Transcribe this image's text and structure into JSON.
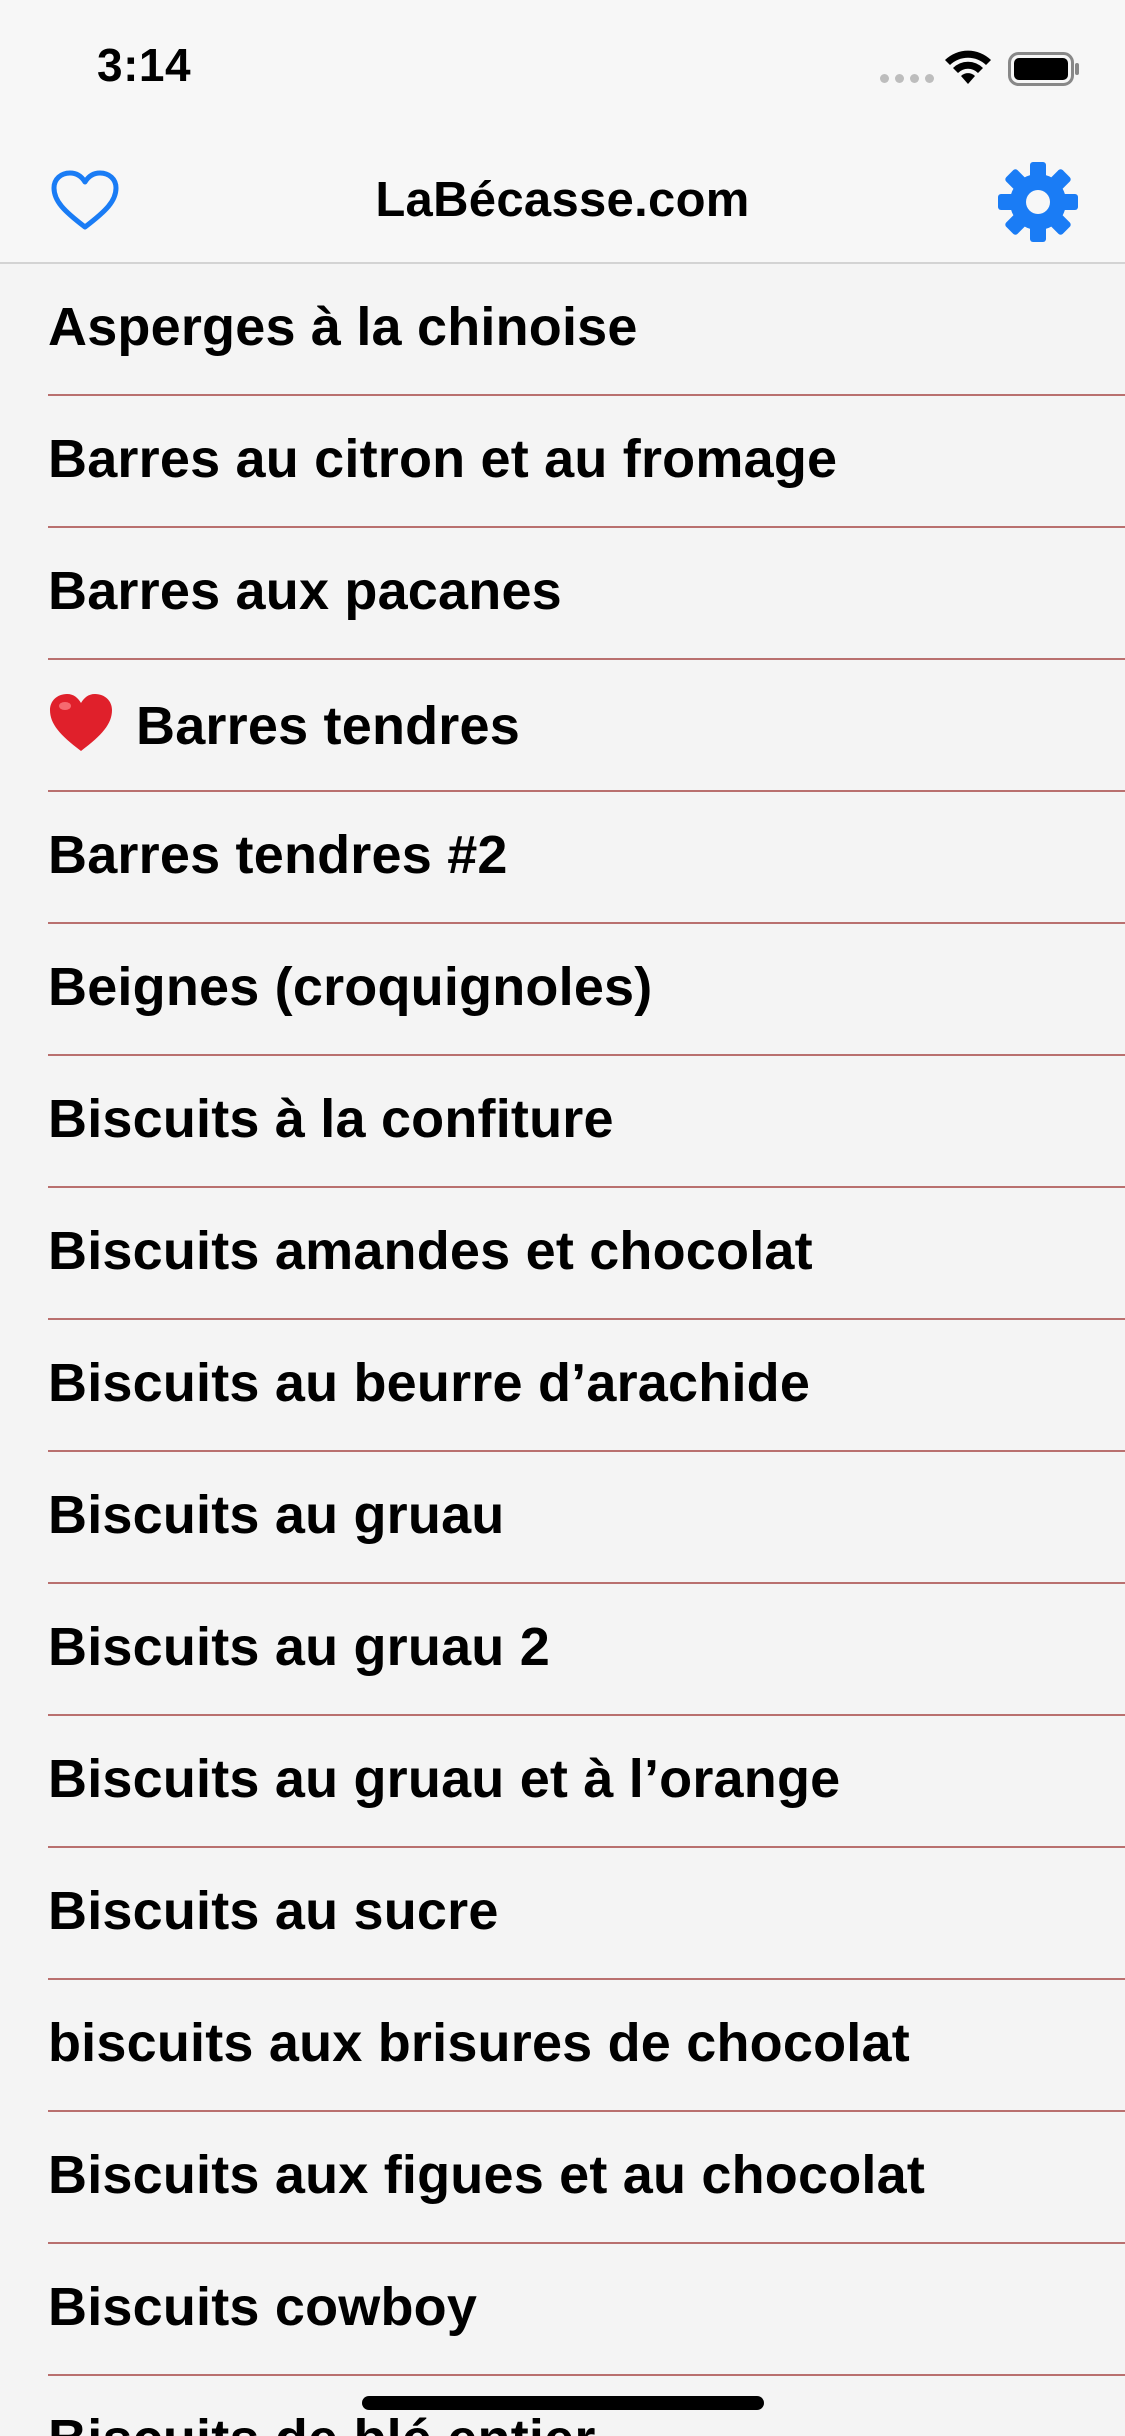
{
  "status_bar": {
    "time": "3:14",
    "wifi_icon": "wifi-icon",
    "battery_icon": "battery-icon"
  },
  "nav": {
    "title": "LaBécasse.com",
    "left_icon": "heart-outline-icon",
    "right_icon": "gear-icon",
    "accent_color": "#1a7cf5"
  },
  "recipes": [
    {
      "label": "Asperges à la chinoise",
      "favorite": false
    },
    {
      "label": "Barres au citron et au fromage",
      "favorite": false
    },
    {
      "label": "Barres aux pacanes",
      "favorite": false
    },
    {
      "label": "Barres tendres",
      "favorite": true
    },
    {
      "label": "Barres tendres #2",
      "favorite": false
    },
    {
      "label": "Beignes (croquignoles)",
      "favorite": false
    },
    {
      "label": "Biscuits à la confiture",
      "favorite": false
    },
    {
      "label": "Biscuits amandes et chocolat",
      "favorite": false
    },
    {
      "label": "Biscuits au beurre d’arachide",
      "favorite": false
    },
    {
      "label": "Biscuits au gruau",
      "favorite": false
    },
    {
      "label": "Biscuits au gruau 2",
      "favorite": false
    },
    {
      "label": "Biscuits au gruau et à l’orange",
      "favorite": false
    },
    {
      "label": "Biscuits au sucre",
      "favorite": false
    },
    {
      "label": "biscuits aux brisures de chocolat",
      "favorite": false
    },
    {
      "label": "Biscuits aux figues et au chocolat",
      "favorite": false
    },
    {
      "label": "Biscuits cowboy",
      "favorite": false
    },
    {
      "label": "Biscuits de blé entier",
      "favorite": false
    }
  ],
  "colors": {
    "separator": "#b9706f",
    "favorite_heart": "#e0202b"
  }
}
